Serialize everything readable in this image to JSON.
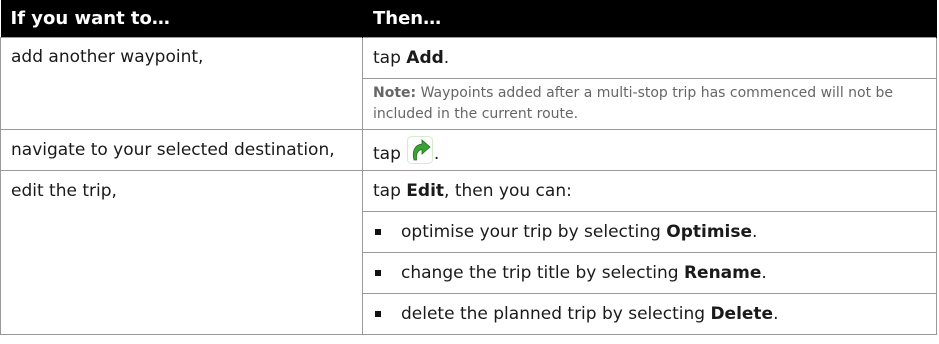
{
  "table": {
    "header": {
      "left": "If you want to…",
      "right": "Then…"
    },
    "rows": [
      {
        "left": "add another waypoint,",
        "right_prefix": "tap ",
        "right_bold": "Add",
        "right_suffix": "."
      },
      {
        "note_label": "Note:",
        "note_text": " Waypoints added after a multi-stop trip has commenced will not be included in the current route."
      },
      {
        "left": "navigate to your selected destination,",
        "right_prefix": "tap",
        "right_suffix": ".",
        "icon": "green-curved-arrow-icon"
      },
      {
        "left": "edit the trip,",
        "right_prefix": "tap ",
        "right_bold": "Edit",
        "right_suffix": ", then you can:"
      },
      {
        "bullet_prefix": "optimise your trip by selecting ",
        "bullet_bold": "Optimise",
        "bullet_suffix": "."
      },
      {
        "bullet_prefix": "change the trip title by selecting ",
        "bullet_bold": "Rename",
        "bullet_suffix": "."
      },
      {
        "bullet_prefix": "delete the planned trip by selecting ",
        "bullet_bold": "Delete",
        "bullet_suffix": "."
      }
    ]
  },
  "colors": {
    "header_bg": "#000000",
    "header_text": "#ffffff",
    "border": "#999999",
    "note_text": "#666666",
    "icon_green": "#3aa335"
  }
}
